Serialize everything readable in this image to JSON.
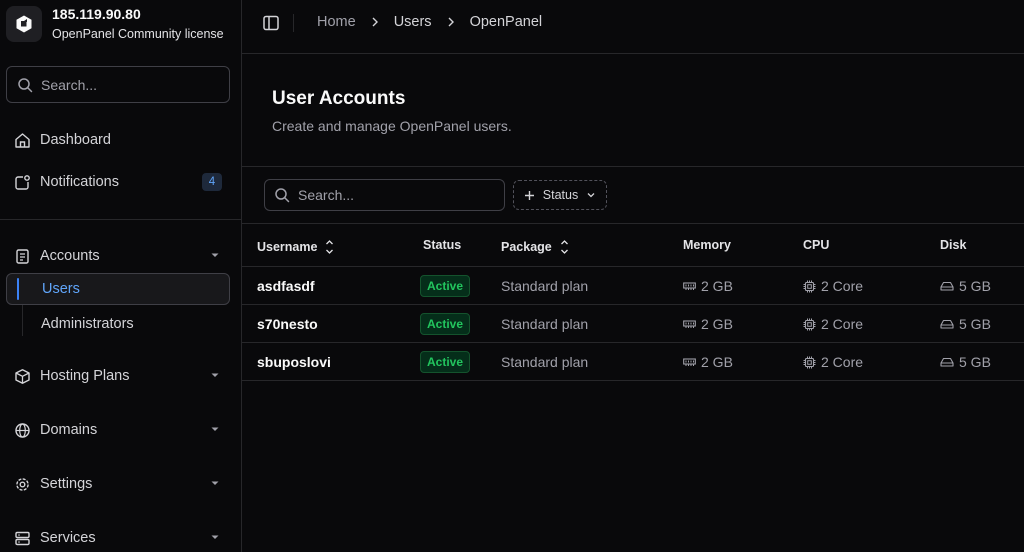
{
  "brand": {
    "ip": "185.119.90.80",
    "license": "OpenPanel Community license"
  },
  "sidebar": {
    "search_placeholder": "Search...",
    "items": [
      {
        "label": "Dashboard",
        "icon": "home-icon"
      },
      {
        "label": "Notifications",
        "icon": "bell-icon",
        "badge": "4"
      },
      {
        "label": "Accounts",
        "icon": "accounts-icon",
        "expanded": true
      },
      {
        "label": "Hosting Plans",
        "icon": "package-icon"
      },
      {
        "label": "Domains",
        "icon": "globe-icon"
      },
      {
        "label": "Settings",
        "icon": "gear-icon"
      },
      {
        "label": "Services",
        "icon": "server-icon"
      }
    ],
    "subitems": [
      {
        "label": "Users",
        "active": true
      },
      {
        "label": "Administrators",
        "active": false
      }
    ]
  },
  "breadcrumb": [
    "Home",
    "Users",
    "OpenPanel"
  ],
  "page": {
    "title": "User Accounts",
    "subtitle": "Create and manage OpenPanel users."
  },
  "filters": {
    "search_placeholder": "Search...",
    "status_label": "Status"
  },
  "table": {
    "columns": [
      "Username",
      "Status",
      "Package",
      "Memory",
      "CPU",
      "Disk"
    ],
    "rows": [
      {
        "username": "asdfasdf",
        "status": "Active",
        "package": "Standard plan",
        "memory": "2 GB",
        "cpu": "2 Core",
        "disk": "5 GB"
      },
      {
        "username": "s70nesto",
        "status": "Active",
        "package": "Standard plan",
        "memory": "2 GB",
        "cpu": "2 Core",
        "disk": "5 GB"
      },
      {
        "username": "sbuposlovi",
        "status": "Active",
        "package": "Standard plan",
        "memory": "2 GB",
        "cpu": "2 Core",
        "disk": "5 GB"
      }
    ]
  },
  "colors": {
    "accent": "#3b82f6",
    "active_status": "#22c55e",
    "background": "#09090b"
  }
}
